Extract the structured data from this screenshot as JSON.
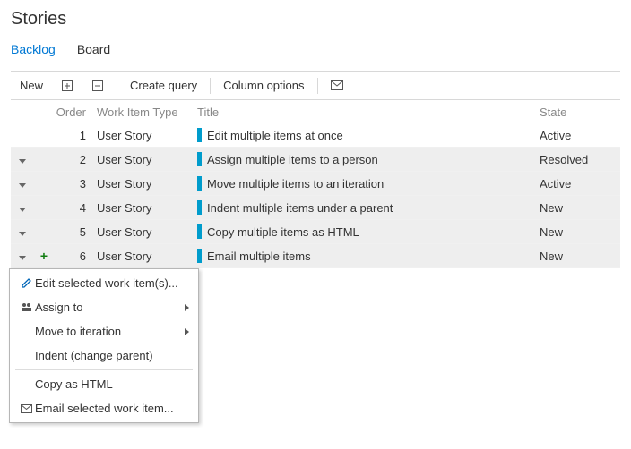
{
  "page_title": "Stories",
  "tabs": {
    "backlog": "Backlog",
    "board": "Board"
  },
  "toolbar": {
    "new": "New",
    "create_query": "Create query",
    "column_options": "Column options"
  },
  "grid": {
    "headers": {
      "order": "Order",
      "type": "Work Item Type",
      "title": "Title",
      "state": "State"
    },
    "rows": [
      {
        "order": "1",
        "type": "User Story",
        "title": "Edit multiple items at once",
        "state": "Active",
        "alt": false,
        "chev": false,
        "plus": false
      },
      {
        "order": "2",
        "type": "User Story",
        "title": "Assign multiple items to a person",
        "state": "Resolved",
        "alt": true,
        "chev": true,
        "plus": false
      },
      {
        "order": "3",
        "type": "User Story",
        "title": "Move multiple items to an iteration",
        "state": "Active",
        "alt": true,
        "chev": true,
        "plus": false
      },
      {
        "order": "4",
        "type": "User Story",
        "title": "Indent multiple items under a parent",
        "state": "New",
        "alt": true,
        "chev": true,
        "plus": false
      },
      {
        "order": "5",
        "type": "User Story",
        "title": "Copy multiple items as HTML",
        "state": "New",
        "alt": true,
        "chev": true,
        "plus": false
      },
      {
        "order": "6",
        "type": "User Story",
        "title": "Email multiple items",
        "state": "New",
        "alt": true,
        "chev": true,
        "plus": true
      }
    ]
  },
  "context_menu": {
    "edit": "Edit selected work item(s)...",
    "assign": "Assign to",
    "move": "Move to iteration",
    "indent": "Indent (change parent)",
    "copy_html": "Copy as HTML",
    "email": "Email selected work item..."
  }
}
